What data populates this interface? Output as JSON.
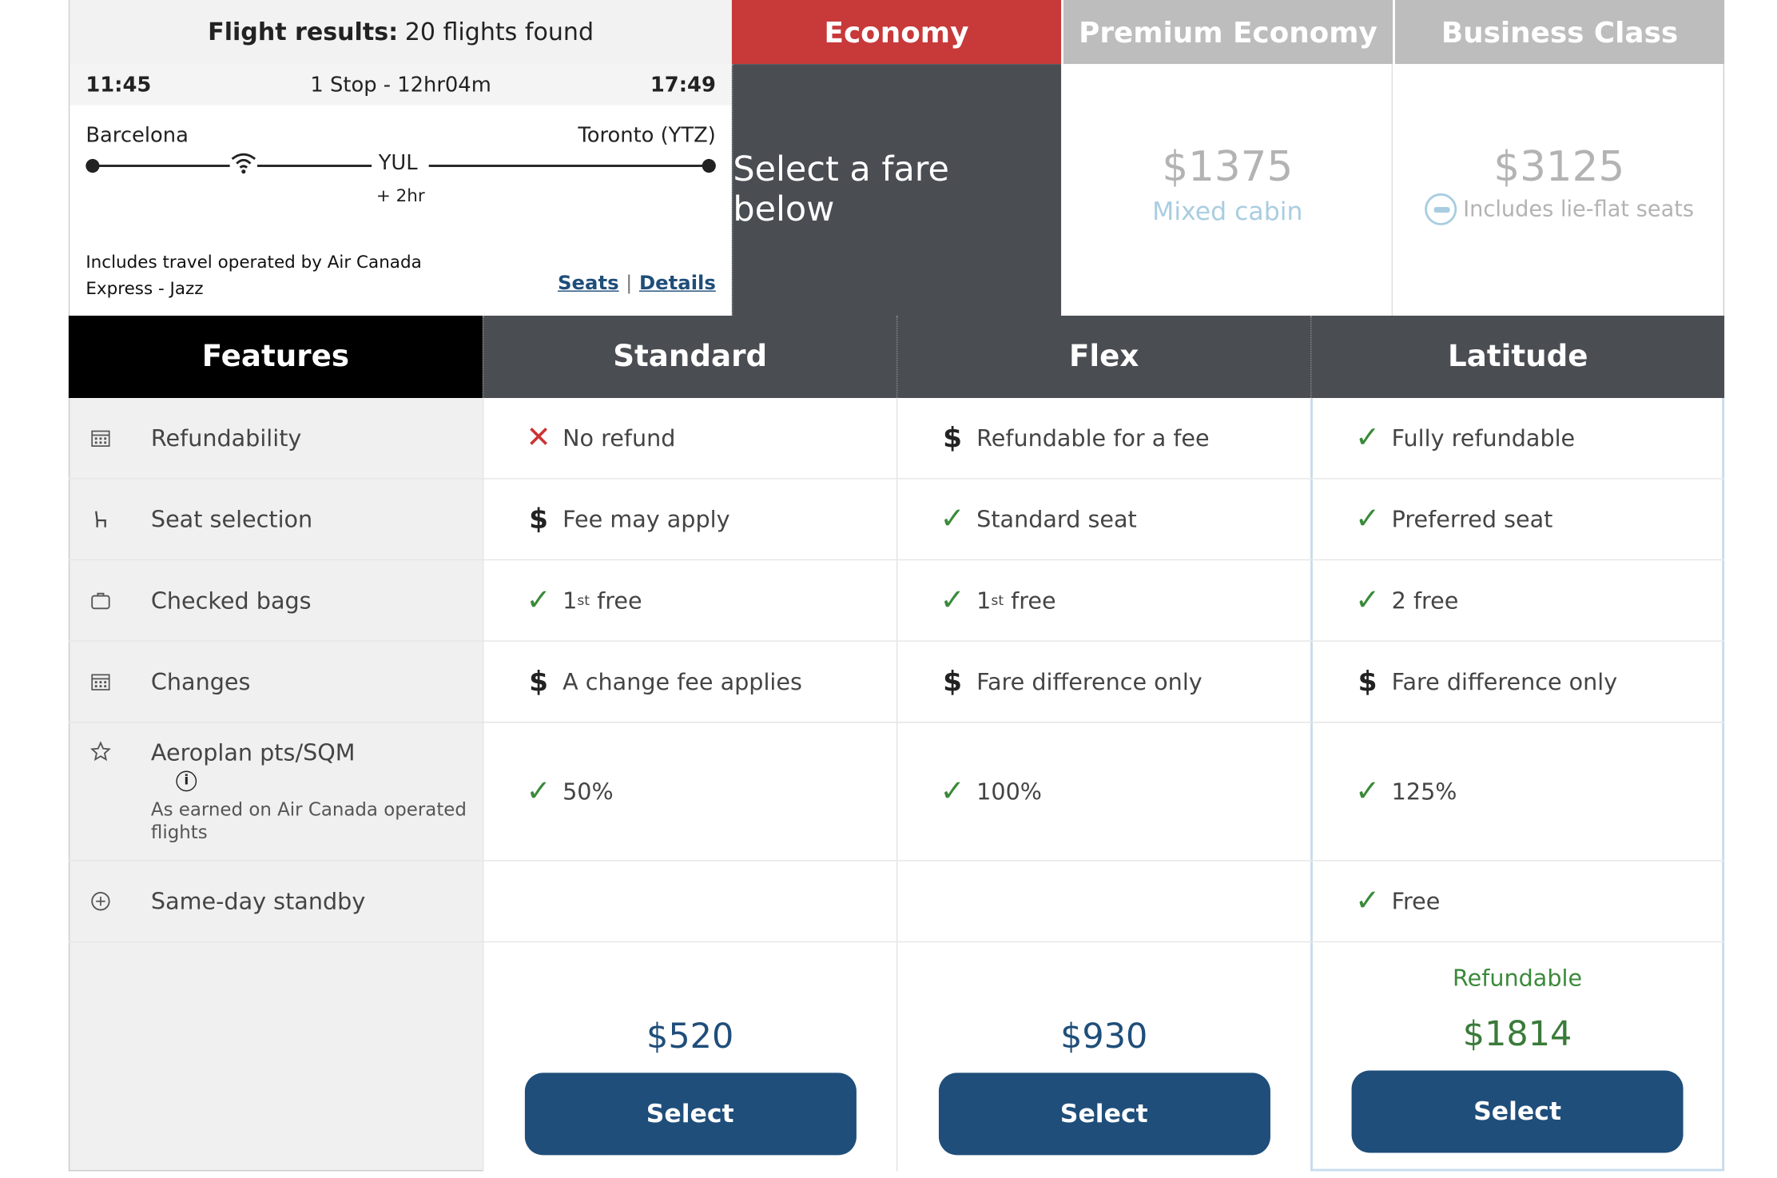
{
  "flight": {
    "results_label": "Flight results:",
    "results_count": "20 flights found",
    "depart_time": "11:45",
    "stops": "1 Stop - 12hr04m",
    "arrive_time": "17:49",
    "origin": "Barcelona",
    "destination": "Toronto (YTZ)",
    "connection": "YUL",
    "connection_offset": "+ 2hr",
    "operated_by": "Includes travel operated by Air Canada Express - Jazz",
    "seats_link": "Seats",
    "separator": "|",
    "details_link": "Details"
  },
  "cabins": {
    "economy": {
      "label": "Economy",
      "prompt": "Select a fare below"
    },
    "premium": {
      "label": "Premium Economy",
      "price": "$1375",
      "note": "Mixed cabin"
    },
    "business": {
      "label": "Business Class",
      "price": "$3125",
      "note": "Includes lie-flat seats"
    }
  },
  "table": {
    "headers": [
      "Features",
      "Standard",
      "Flex",
      "Latitude"
    ],
    "rows": [
      {
        "feature": "Refundability",
        "icon": "calendar-icon",
        "cells": [
          {
            "mark": "cross",
            "text": "No refund"
          },
          {
            "mark": "dollar",
            "text": "Refundable for a fee"
          },
          {
            "mark": "check",
            "text": "Fully refundable"
          }
        ]
      },
      {
        "feature": "Seat selection",
        "icon": "seat-icon",
        "cells": [
          {
            "mark": "dollar",
            "text": "Fee may apply"
          },
          {
            "mark": "check",
            "text": "Standard seat"
          },
          {
            "mark": "check",
            "text": "Preferred seat"
          }
        ]
      },
      {
        "feature": "Checked bags",
        "icon": "bag-icon",
        "cells": [
          {
            "mark": "check",
            "text": "1",
            "sup": "st",
            "rest": " free"
          },
          {
            "mark": "check",
            "text": "1",
            "sup": "st",
            "rest": " free"
          },
          {
            "mark": "check",
            "text": "2 free"
          }
        ]
      },
      {
        "feature": "Changes",
        "icon": "calendar-icon",
        "cells": [
          {
            "mark": "dollar",
            "text": "A change fee applies"
          },
          {
            "mark": "dollar",
            "text": "Fare difference only"
          },
          {
            "mark": "dollar",
            "text": "Fare difference only"
          }
        ]
      },
      {
        "feature": "Aeroplan pts/SQM",
        "icon": "star-icon",
        "sub": "As earned on Air Canada operated flights",
        "cells": [
          {
            "mark": "check",
            "text": "50%"
          },
          {
            "mark": "check",
            "text": "100%"
          },
          {
            "mark": "check",
            "text": "125%"
          }
        ]
      },
      {
        "feature": "Same-day standby",
        "icon": "standby-icon",
        "cells": [
          {
            "mark": "",
            "text": ""
          },
          {
            "mark": "",
            "text": ""
          },
          {
            "mark": "check",
            "text": "Free"
          }
        ]
      }
    ],
    "prices": {
      "standard": "$520",
      "flex": "$930",
      "latitude": "$1814",
      "latitude_tag": "Refundable",
      "select_label": "Select"
    }
  },
  "colors": {
    "economy_red": "#c8393a",
    "navy": "#1f4e7a",
    "check_green": "#3a8a3a",
    "dark_header": "#4a4d52"
  }
}
